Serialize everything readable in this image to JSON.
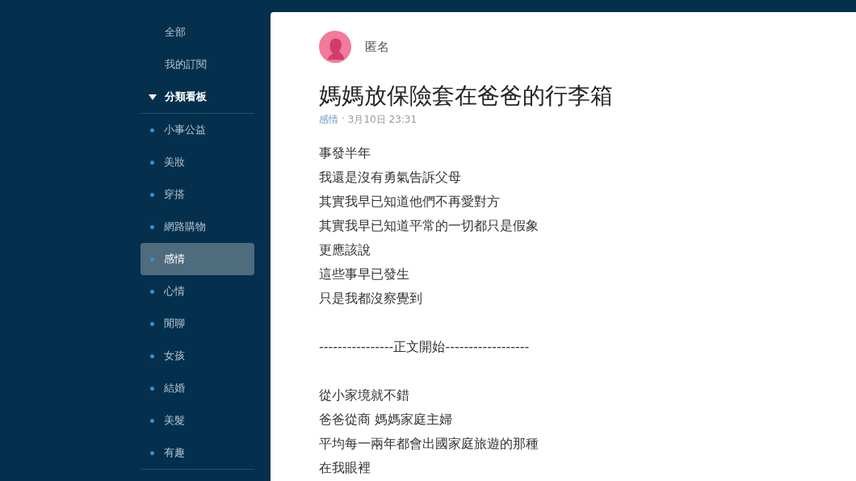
{
  "sidebar": {
    "links": [
      {
        "label": "全部",
        "selected": false
      },
      {
        "label": "我的訂閱",
        "selected": false
      }
    ],
    "section": {
      "label": "分類看板",
      "expanded": true
    },
    "boards": [
      {
        "label": "小事公益",
        "selected": false
      },
      {
        "label": "美妝",
        "selected": false
      },
      {
        "label": "穿搭",
        "selected": false
      },
      {
        "label": "網路購物",
        "selected": false
      },
      {
        "label": "感情",
        "selected": true
      },
      {
        "label": "心情",
        "selected": false
      },
      {
        "label": "閒聊",
        "selected": false
      },
      {
        "label": "女孩",
        "selected": false
      },
      {
        "label": "結婚",
        "selected": false
      },
      {
        "label": "美髮",
        "selected": false
      },
      {
        "label": "有趣",
        "selected": false
      }
    ]
  },
  "post": {
    "author": "匿名",
    "title": "媽媽放保險套在爸爸的行李箱",
    "board": "感情",
    "separator": "·",
    "time": "3月10日 23:31",
    "paragraphs": [
      [
        "事發半年",
        "我還是沒有勇氣告訴父母",
        "其實我早已知道他們不再愛對方",
        "其實我早已知道平常的一切都只是假象",
        "更應該說",
        "這些事早已發生",
        "只是我都沒察覺到"
      ],
      [
        "----------------正文開始------------------"
      ],
      [
        "從小家境就不錯",
        "爸爸從商 媽媽家庭主婦",
        "平均每一兩年都會出國家庭旅遊的那種",
        "在我眼裡"
      ]
    ]
  }
}
